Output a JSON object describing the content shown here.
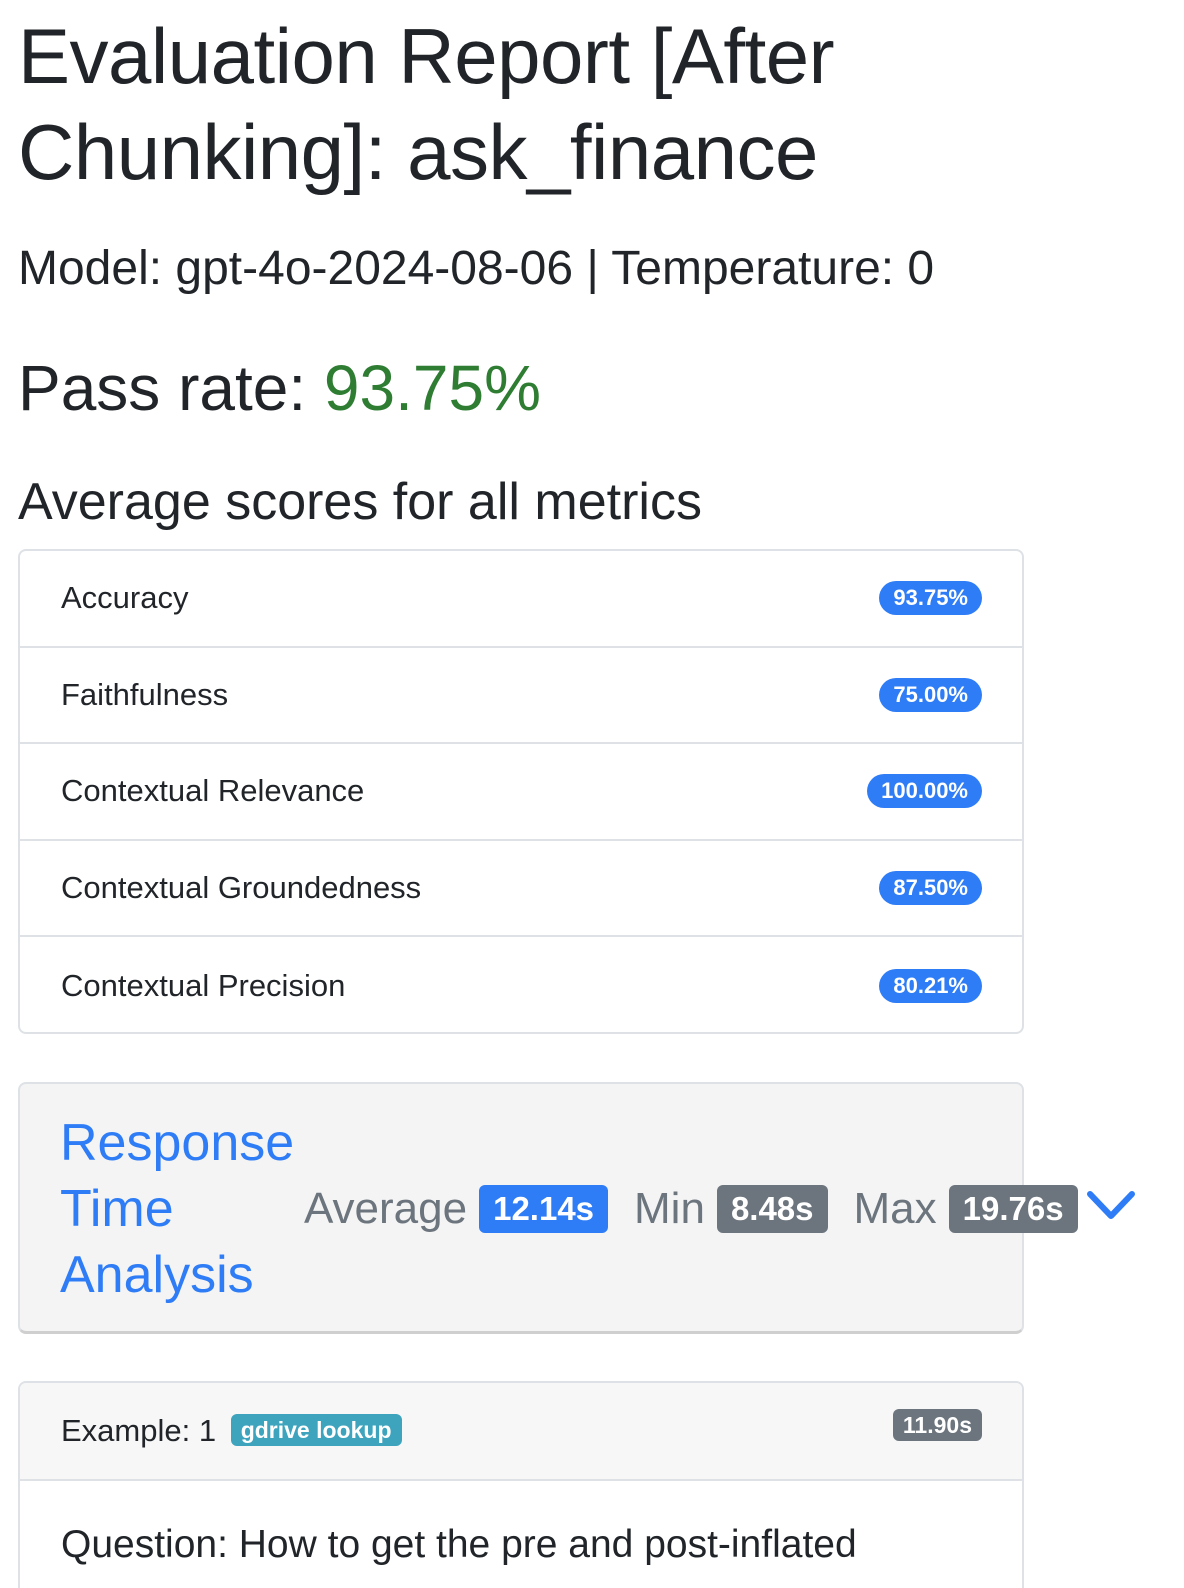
{
  "header": {
    "title": "Evaluation Report [After Chunking]: ask_finance",
    "model_line": "Model: gpt-4o-2024-08-06 | Temperature: 0",
    "pass_rate_label": "Pass rate:",
    "pass_rate_value": "93.75%",
    "pass_rate_color": "#2e7d32"
  },
  "metrics": {
    "heading": "Average scores for all metrics",
    "items": [
      {
        "label": "Accuracy",
        "value": "93.75%"
      },
      {
        "label": "Faithfulness",
        "value": "75.00%"
      },
      {
        "label": "Contextual Relevance",
        "value": "100.00%"
      },
      {
        "label": "Contextual Groundedness",
        "value": "87.50%"
      },
      {
        "label": "Contextual Precision",
        "value": "80.21%"
      }
    ],
    "badge_color": "#2f7df6"
  },
  "response_time": {
    "title": "Response Time Analysis",
    "average_label": "Average",
    "average_value": "12.14s",
    "min_label": "Min",
    "min_value": "8.48s",
    "max_label": "Max",
    "max_value": "19.76s",
    "toggle_icon": "chevron-down-icon"
  },
  "example": {
    "label": "Example: 1",
    "tag": "gdrive lookup",
    "time": "11.90s",
    "question": "Question: How to get the pre and post-inflated"
  }
}
